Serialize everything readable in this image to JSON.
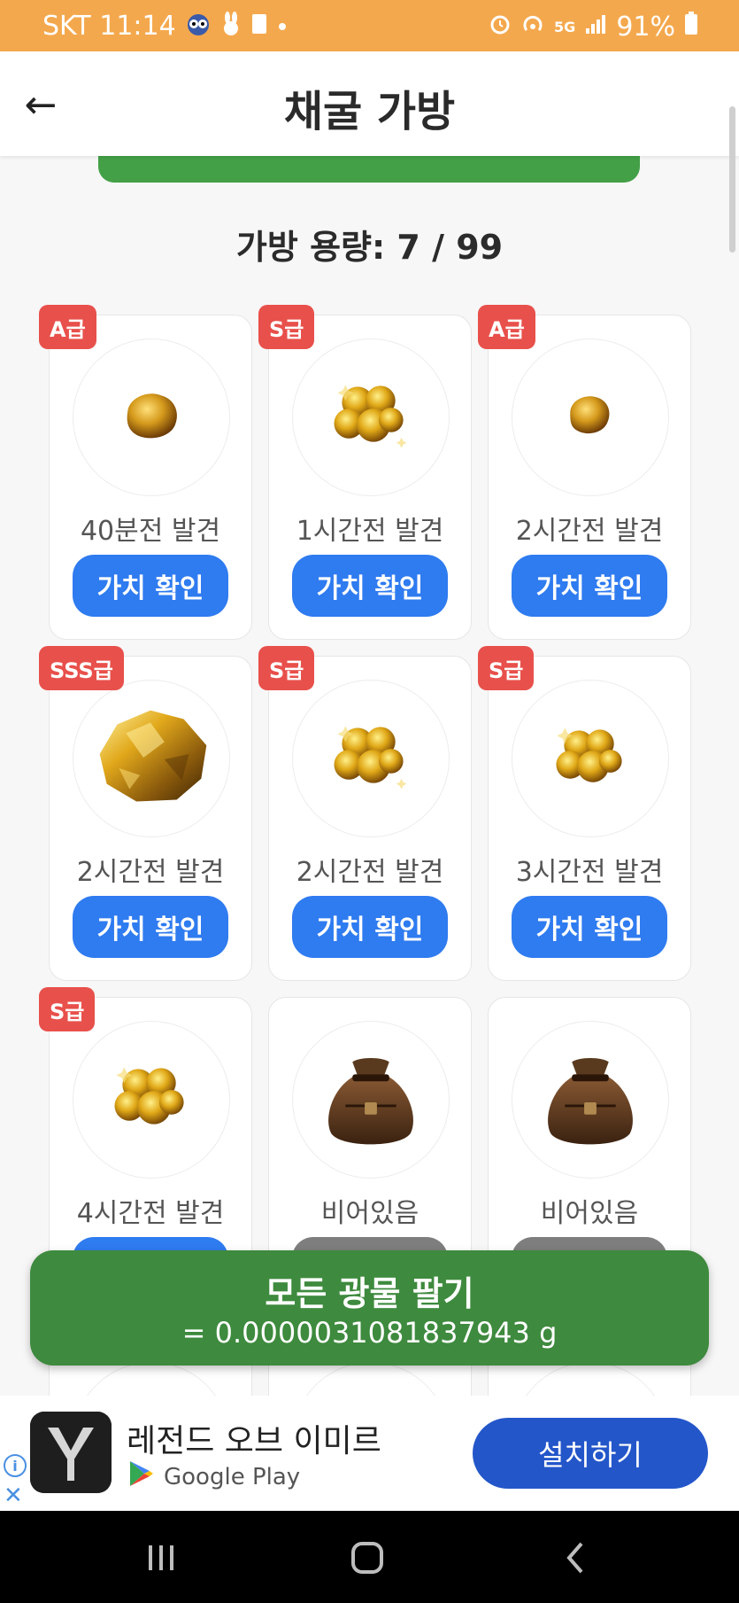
{
  "status_bar": {
    "carrier_time": "SKT 11:14",
    "network": "5G",
    "battery": "91%"
  },
  "header": {
    "back_icon": "←",
    "title": "채굴 가방"
  },
  "bag": {
    "capacity_label": "가방 용량: 7 / 99"
  },
  "items": [
    {
      "grade": "A급",
      "found": "40분전 발견",
      "button": "가치 확인",
      "icon": "gold-nugget-small-icon"
    },
    {
      "grade": "S급",
      "found": "1시간전 발견",
      "button": "가치 확인",
      "icon": "gold-cluster-icon"
    },
    {
      "grade": "A급",
      "found": "2시간전 발견",
      "button": "가치 확인",
      "icon": "gold-nugget-small-icon"
    },
    {
      "grade": "SSS급",
      "found": "2시간전 발견",
      "button": "가치 확인",
      "icon": "gold-rock-large-icon"
    },
    {
      "grade": "S급",
      "found": "2시간전 발견",
      "button": "가치 확인",
      "icon": "gold-cluster-icon"
    },
    {
      "grade": "S급",
      "found": "3시간전 발견",
      "button": "가치 확인",
      "icon": "gold-cluster-icon"
    },
    {
      "grade": "S급",
      "found": "4시간전 발견",
      "button": "가치 확인",
      "icon": "gold-cluster-icon"
    },
    {
      "grade": "",
      "found": "비어있음",
      "button": "",
      "icon": "leather-pouch-icon"
    },
    {
      "grade": "",
      "found": "비어있음",
      "button": "",
      "icon": "leather-pouch-icon"
    }
  ],
  "sell_all": {
    "label": "모든 광물 팔기",
    "total": "= 0.0000031081837943 g"
  },
  "ad": {
    "title": "레전드 오브 이미르",
    "store": "Google Play",
    "install": "설치하기"
  },
  "colors": {
    "status_bar": "#f4a84d",
    "green": "#3e8a3e",
    "blue_button": "#2f7bf0",
    "badge_red": "#e8504b",
    "install_blue": "#2356c9"
  }
}
